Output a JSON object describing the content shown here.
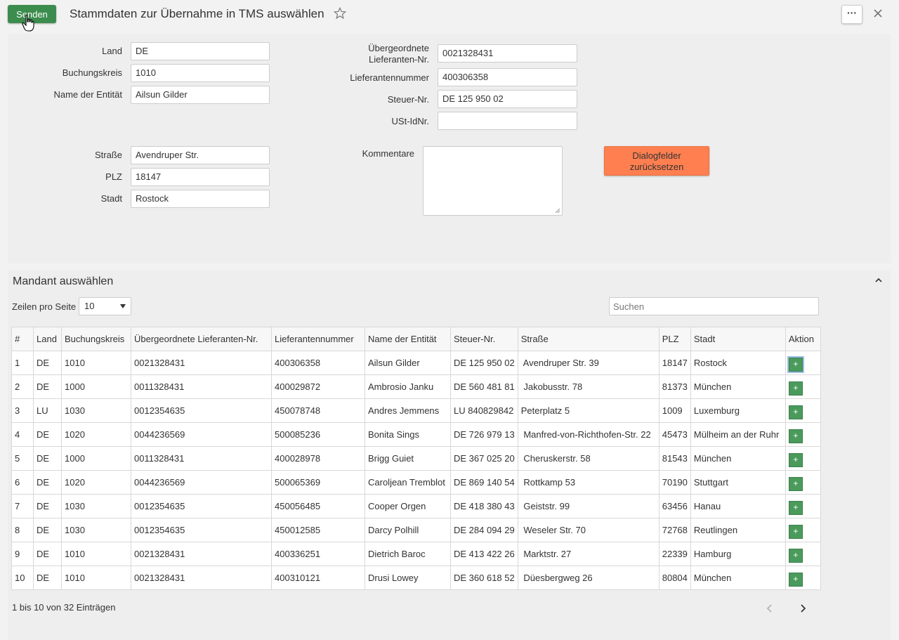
{
  "header": {
    "send_label": "Senden",
    "title": "Stammdaten zur Übernahme in TMS auswählen",
    "more_label": "···"
  },
  "form": {
    "land_label": "Land",
    "land_value": "DE",
    "buchungskreis_label": "Buchungskreis",
    "buchungskreis_value": "1010",
    "name_label": "Name der Entität",
    "name_value": "Ailsun Gilder",
    "strasse_label": "Straße",
    "strasse_value": "Avendruper Str.",
    "plz_label": "PLZ",
    "plz_value": "18147",
    "stadt_label": "Stadt",
    "stadt_value": "Rostock",
    "ueber_label_1": "Übergeordnete",
    "ueber_label_2": "Lieferanten-Nr.",
    "ueber_value": "0021328431",
    "liefer_label": "Lieferantennummer",
    "liefer_value": "400306358",
    "steuer_label": "Steuer-Nr.",
    "steuer_value": "DE 125 950 02",
    "ust_label": "USt-IdNr.",
    "ust_value": "",
    "kommentare_label": "Kommentare",
    "reset_label_1": "Dialogfelder",
    "reset_label_2": "zurücksetzen"
  },
  "table_section": {
    "title": "Mandant auswählen",
    "rows_per_page_label": "Zeilen pro Seite",
    "rows_per_page_value": "10",
    "search_placeholder": "Suchen",
    "columns": [
      "#",
      "Land",
      "Buchungskreis",
      "Übergeordnete Lieferanten-Nr.",
      "Lieferantennummer",
      "Name der Entität",
      "Steuer-Nr.",
      "Straße",
      "PLZ",
      "Stadt",
      "Aktion"
    ],
    "rows": [
      [
        "1",
        "DE",
        "1010",
        "0021328431",
        "400306358",
        "Ailsun Gilder",
        "DE 125 950 02",
        " Avendruper Str. 39",
        "18147",
        "Rostock"
      ],
      [
        "2",
        "DE",
        "1000",
        "0011328431",
        "400029872",
        "Ambrosio Janku",
        "DE 560 481 81",
        " Jakobusstr. 78",
        "81373",
        "München"
      ],
      [
        "3",
        "LU",
        "1030",
        "0012354635",
        "450078748",
        "Andres Jemmens",
        "LU 840829842",
        "Peterplatz 5",
        "1009",
        "Luxemburg"
      ],
      [
        "4",
        "DE",
        "1020",
        "0044236569",
        "500085236",
        "Bonita Sings",
        "DE 726 979 13",
        " Manfred-von-Richthofen-Str. 22",
        "45473",
        "Mülheim an der Ruhr"
      ],
      [
        "5",
        "DE",
        "1000",
        "0011328431",
        "400028978",
        "Brigg Guiet",
        "DE 367 025 20",
        " Cheruskerstr. 58",
        "81543",
        "München"
      ],
      [
        "6",
        "DE",
        "1020",
        "0044236569",
        "500065369",
        "Caroljean Tremblot",
        "DE 869 140 54",
        " Rottkamp 53",
        "70190",
        "Stuttgart"
      ],
      [
        "7",
        "DE",
        "1030",
        "0012354635",
        "450056485",
        "Cooper Orgen",
        "DE 418 380 43",
        " Geiststr. 99",
        "63456",
        "Hanau"
      ],
      [
        "8",
        "DE",
        "1030",
        "0012354635",
        "450012585",
        "Darcy Polhill",
        "DE 284 094 29",
        " Weseler Str. 70",
        "72768",
        "Reutlingen"
      ],
      [
        "9",
        "DE",
        "1010",
        "0021328431",
        "400336251",
        "Dietrich Baroc",
        "DE 413 422 26",
        " Marktstr. 27",
        "22339",
        "Hamburg"
      ],
      [
        "10",
        "DE",
        "1010",
        "0021328431",
        "400310121",
        "Drusi Lowey",
        "DE 360 618 52",
        " Düesbergweg 26",
        "80804",
        "München"
      ]
    ],
    "action_label": "+",
    "info": "1 bis 10 von 32 Einträgen"
  },
  "colors": {
    "send_green": "#3c8c4e",
    "reset_orange": "#ff7f50",
    "add_green": "#4a9a5c"
  }
}
